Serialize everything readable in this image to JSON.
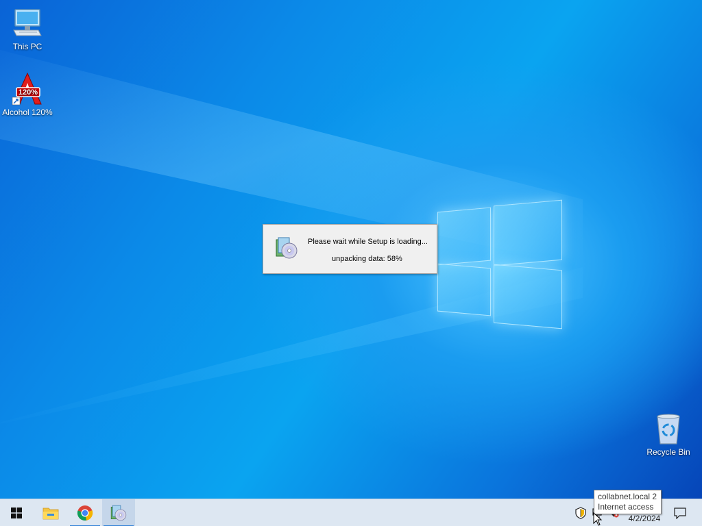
{
  "desktop": {
    "icons": [
      {
        "label": "This PC",
        "icon": "computer-icon"
      },
      {
        "label": "Alcohol 120%",
        "icon": "alcohol-120-icon",
        "badge": "120%"
      },
      {
        "label": "Recycle Bin",
        "icon": "recycle-bin-icon"
      }
    ]
  },
  "setup_dialog": {
    "message": "Please wait while Setup is loading...",
    "progress_text": "unpacking data: 58%",
    "progress_value": 58,
    "icon": "setup-disc-icon"
  },
  "taskbar": {
    "buttons": [
      {
        "name": "start",
        "icon": "windows-start-icon"
      },
      {
        "name": "file-explorer",
        "icon": "folder-icon"
      },
      {
        "name": "chrome",
        "icon": "chrome-icon"
      },
      {
        "name": "setup",
        "icon": "setup-disc-icon",
        "active": true
      }
    ],
    "tray": {
      "icons": [
        "security-shield-icon",
        "network-icon",
        "volume-muted-icon",
        "notification-icon"
      ],
      "date": "4/2/2024"
    }
  },
  "tooltip": {
    "line1": "collabnet.local 2",
    "line2": "Internet access"
  },
  "colors": {
    "desktop_blue": "#0a8ae8",
    "taskbar": "#dde7f2",
    "dialog_bg": "#f0f0f0"
  }
}
